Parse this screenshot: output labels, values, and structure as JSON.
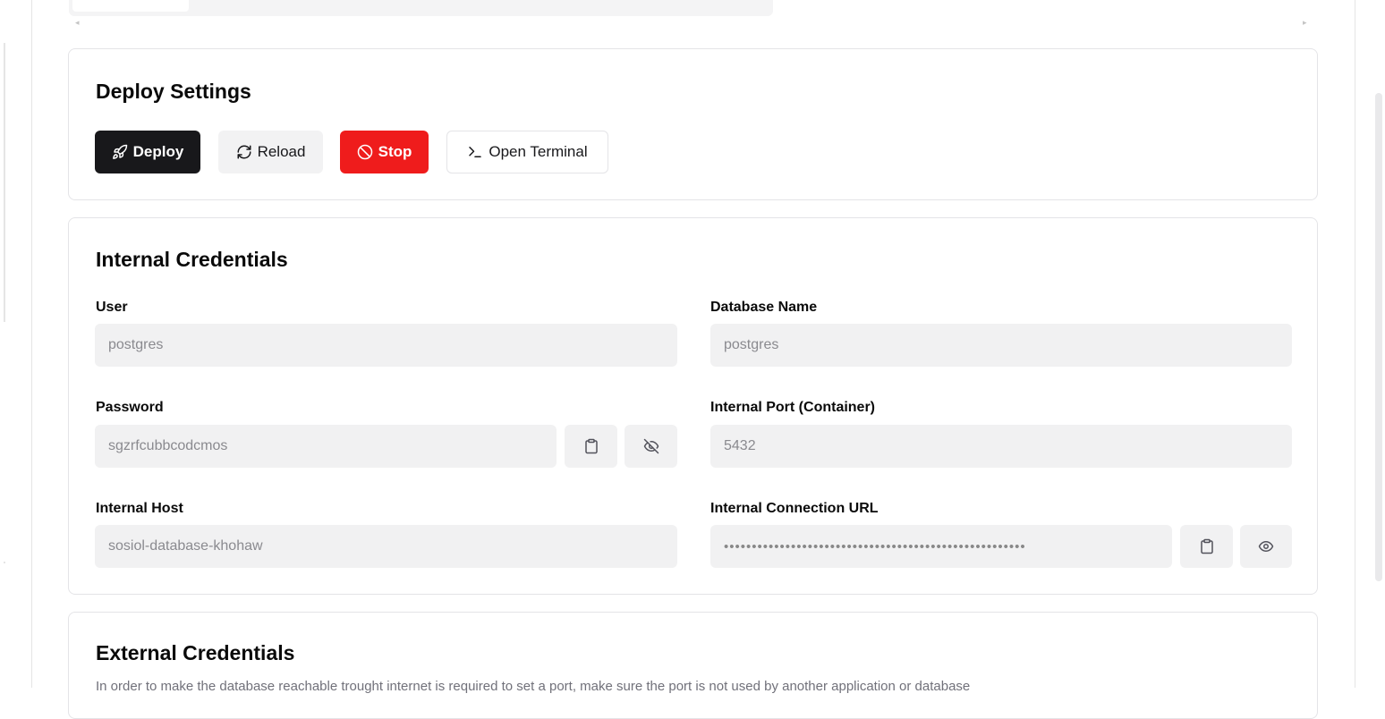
{
  "deploy_settings": {
    "title": "Deploy Settings",
    "buttons": {
      "deploy": "Deploy",
      "reload": "Reload",
      "stop": "Stop",
      "open_terminal": "Open Terminal"
    }
  },
  "internal_credentials": {
    "title": "Internal Credentials",
    "user": {
      "label": "User",
      "value": "postgres"
    },
    "database_name": {
      "label": "Database Name",
      "value": "postgres"
    },
    "password": {
      "label": "Password",
      "value": "sgzrfcubbcodcmos"
    },
    "internal_port": {
      "label": "Internal Port (Container)",
      "value": "5432"
    },
    "internal_host": {
      "label": "Internal Host",
      "value": "sosiol-database-khohaw"
    },
    "internal_connection_url": {
      "label": "Internal Connection URL",
      "value": "••••••••••••••••••••••••••••••••••••••••••••••••••••••"
    }
  },
  "external_credentials": {
    "title": "External Credentials",
    "description": "In order to make the database reachable trought internet is required to set a port, make sure the port is not used by another application or database"
  },
  "colors": {
    "primary": "#18181b",
    "danger": "#ef1c1c",
    "field_bg": "#f1f1f2",
    "border": "#e4e4e7"
  },
  "icons": {
    "deploy": "rocket-icon",
    "reload": "refresh-icon",
    "stop": "ban-icon",
    "terminal": "terminal-icon",
    "copy": "clipboard-icon",
    "hide": "eye-off-icon",
    "show": "eye-icon"
  }
}
